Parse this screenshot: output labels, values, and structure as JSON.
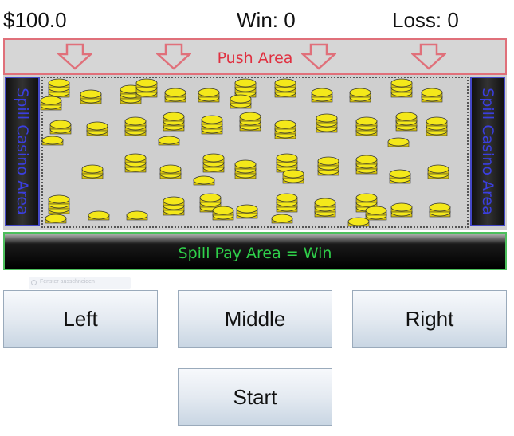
{
  "header": {
    "balance": "$100.0",
    "win": "Win: 0",
    "loss": "Loss: 0"
  },
  "board": {
    "push_label": "Push Area",
    "spill_left_label": "Spill Casino Area",
    "spill_right_label": "Spill Casino Area",
    "pay_label": "Spill Pay Area = Win"
  },
  "tooltip": {
    "text": "Fenster ausschneiden"
  },
  "controls": {
    "left": "Left",
    "middle": "Middle",
    "right": "Right",
    "start": "Start"
  },
  "colors": {
    "coin": "#f4e81a",
    "push_border": "#e0707a",
    "spill_text": "#3a3ee0",
    "pay_text": "#2fd04a"
  }
}
